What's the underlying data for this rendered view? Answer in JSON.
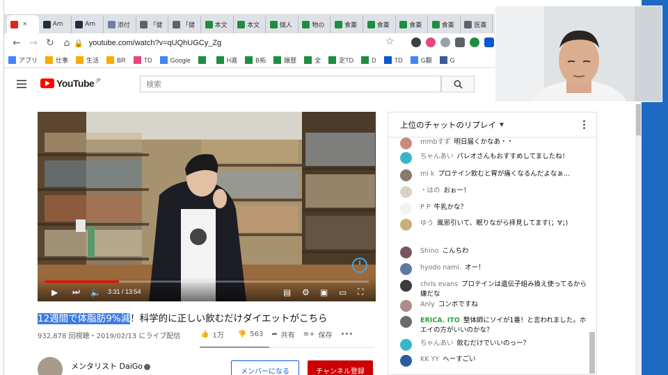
{
  "browser": {
    "tabs": [
      {
        "label": "",
        "color": "#e62117",
        "active": true
      },
      {
        "label": "Am",
        "color": "#232f3e"
      },
      {
        "label": "Am",
        "color": "#232f3e"
      },
      {
        "label": "添付",
        "color": "#6d7fa8"
      },
      {
        "label": "「健",
        "color": "#5f6368"
      },
      {
        "label": "「健",
        "color": "#5f6368"
      },
      {
        "label": "本文",
        "color": "#1e8e3e"
      },
      {
        "label": "本文",
        "color": "#1e8e3e"
      },
      {
        "label": "個人",
        "color": "#1e8e3e"
      },
      {
        "label": "物の",
        "color": "#1e8e3e"
      },
      {
        "label": "食薬",
        "color": "#1e8e3e"
      },
      {
        "label": "食薬",
        "color": "#1e8e3e"
      },
      {
        "label": "食薬",
        "color": "#1e8e3e"
      },
      {
        "label": "食薬",
        "color": "#1e8e3e"
      },
      {
        "label": "医薬",
        "color": "#5f6368"
      }
    ],
    "url": "youtube.com/watch?v=qUQhUGCy_Zg",
    "bookmarks": [
      {
        "label": "アプリ",
        "color": "#4285f4"
      },
      {
        "label": "仕事",
        "color": "#f9ab00"
      },
      {
        "label": "生活",
        "color": "#f9ab00"
      },
      {
        "label": "BR",
        "color": "#f9ab00"
      },
      {
        "label": "TD",
        "color": "#e8467c"
      },
      {
        "label": "Google",
        "color": "#4285f4"
      },
      {
        "label": "",
        "color": "#1e8e3e"
      },
      {
        "label": "H進",
        "color": "#1e8e3e"
      },
      {
        "label": "B拓",
        "color": "#1e8e3e"
      },
      {
        "label": "履歴",
        "color": "#1e8e3e"
      },
      {
        "label": "全",
        "color": "#1e8e3e"
      },
      {
        "label": "定TD",
        "color": "#1e8e3e"
      },
      {
        "label": "D",
        "color": "#1e8e3e"
      },
      {
        "label": "TD",
        "color": "#0b57d0"
      },
      {
        "label": "G翻",
        "color": "#4285f4"
      },
      {
        "label": "G",
        "color": "#3b5998"
      }
    ]
  },
  "youtube": {
    "logo_text": "YouTube",
    "logo_region": "JP",
    "search_placeholder": "検索"
  },
  "video": {
    "progress": 0.23,
    "time": "3:31 / 13:54",
    "title_highlight": "12週間で体脂肪9%減",
    "title_rest": "！科学的に正しい飲むだけダイエットがこちら",
    "meta": "932,878 回視聴・2019/02/13 にライブ配信",
    "likes": "1万",
    "dislikes": "563",
    "share": "共有",
    "save": "保存",
    "more": "•••"
  },
  "channel": {
    "name": "メンタリスト DaiGo",
    "member_button": "メンバーになる",
    "subscribe_button": "チャンネル登録"
  },
  "chat": {
    "header": "上位のチャットのリプレイ",
    "messages": [
      {
        "author": "mmbすず",
        "text": "明日届くかなあ・・",
        "color": "#c98a80"
      },
      {
        "author": "ちゃんあい",
        "text": "パレオさんもおすすめしてましたね！",
        "color": "#35b7c9"
      },
      {
        "author": "mi k",
        "text": "プロテイン飲むと胃が痛くなるんだよなぁ...",
        "color": "#8a7a6a"
      },
      {
        "author": "・はの",
        "text": "おぉー！",
        "color": "#d9d3c6"
      },
      {
        "author": "P P",
        "text": "牛乳かな？",
        "color": "#f2f2f2"
      },
      {
        "author": "ゆう",
        "text": "風邪引いて、眠りながら拝見してます(；∀；)",
        "color": "#c7b07a"
      },
      {
        "author": "Shino",
        "text": "こんちわ",
        "color": "#7a5560"
      },
      {
        "author": "hyodo nami.",
        "text": "オー！",
        "color": "#5f79a5"
      },
      {
        "author": "chris evans",
        "text": "プロテインは遺伝子組み換え使ってるから嫌だな",
        "color": "#3b3b3b"
      },
      {
        "author": "Anly",
        "text": "コンボですね",
        "color": "#b08a86"
      },
      {
        "author": "ERICA. ITO",
        "text": "整体師にソイが1番！と言われました。ホエイの方がいいのかな？",
        "color": "#6b6b6b"
      },
      {
        "author": "ちゃんあい",
        "text": "飲むだけでいいのっー？",
        "color": "#35b7c9"
      },
      {
        "author": "KK YY",
        "text": "へーすごい",
        "color": "#2b5c9c"
      }
    ]
  }
}
